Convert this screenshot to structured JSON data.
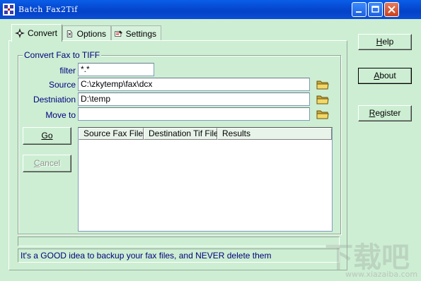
{
  "window": {
    "title": "Batch Fax2Tif",
    "controls": [
      "minimize-icon",
      "maximize-icon",
      "close-icon"
    ]
  },
  "tabs": [
    {
      "label": "Convert",
      "icon": "compass-icon",
      "active": true
    },
    {
      "label": "Options",
      "icon": "options-icon",
      "active": false
    },
    {
      "label": "Settings",
      "icon": "settings-icon",
      "active": false
    }
  ],
  "group": {
    "title": "Convert Fax to TIFF"
  },
  "fields": {
    "filter": {
      "label": "filter",
      "value": "*.*"
    },
    "source": {
      "label": "Source",
      "value": "C:\\zkytemp\\fax\\dcx"
    },
    "destination": {
      "label": "Destniation",
      "value": "D:\\temp"
    },
    "move_to": {
      "label": "Move to",
      "value": ""
    }
  },
  "buttons": {
    "go": {
      "label": "Go",
      "underline": "G"
    },
    "cancel": {
      "label": "Cancel",
      "underline": "C"
    },
    "help": {
      "label": "Help",
      "underline": "H"
    },
    "about": {
      "label": "About",
      "underline": "A"
    },
    "register": {
      "label": "Register",
      "underline": "R"
    }
  },
  "results_list": {
    "columns": [
      "Source Fax Files",
      "Destination Tif Files",
      "Results"
    ],
    "rows": []
  },
  "status_text": "It's a GOOD idea to backup your fax files, and NEVER delete them",
  "watermark": {
    "text": "下载吧",
    "url": "www.xiazaiba.com"
  },
  "colors": {
    "titlebar": "#0341c8",
    "background": "#cdeed3",
    "label_text": "#000080",
    "folder": "#e8c84a"
  }
}
